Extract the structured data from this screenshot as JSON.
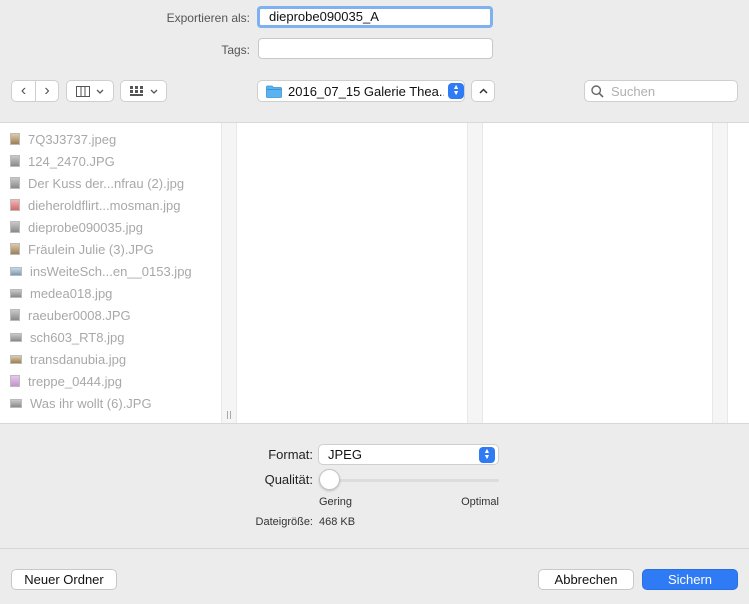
{
  "export": {
    "label": "Exportieren als:",
    "value": "dieprobe090035_A",
    "tags_label": "Tags:",
    "tags_value": ""
  },
  "toolbar": {
    "back_glyph": "‹",
    "forward_glyph": "›",
    "view_columns_icon": "columns-view-icon",
    "view_grid_icon": "grid-view-icon",
    "location": "2016_07_15 Galerie Thea...",
    "expand_glyph": "⌃",
    "search_placeholder": "Suchen"
  },
  "files": [
    {
      "name": "7Q3J3737.jpeg",
      "thumb": "tan"
    },
    {
      "name": "124_2470.JPG",
      "thumb": "gray"
    },
    {
      "name": "Der Kuss der...nfrau (2).jpg",
      "thumb": "gray"
    },
    {
      "name": "dieheroldflirt...mosman.jpg",
      "thumb": "red"
    },
    {
      "name": "dieprobe090035.jpg",
      "thumb": "gray"
    },
    {
      "name": "Fräulein Julie (3).JPG",
      "thumb": "tan"
    },
    {
      "name": "insWeiteSch...en__0153.jpg",
      "thumb": "blue"
    },
    {
      "name": "medea018.jpg",
      "thumb": "gray"
    },
    {
      "name": "raeuber0008.JPG",
      "thumb": "gray"
    },
    {
      "name": "sch603_RT8.jpg",
      "thumb": "gray"
    },
    {
      "name": "transdanubia.jpg",
      "thumb": "tan"
    },
    {
      "name": "treppe_0444.jpg",
      "thumb": "pink"
    },
    {
      "name": "Was ihr wollt (6).JPG",
      "thumb": "gray"
    }
  ],
  "options": {
    "format_label": "Format:",
    "format_value": "JPEG",
    "quality_label": "Qualität:",
    "quality_value": 0,
    "quality_min": "Gering",
    "quality_max": "Optimal",
    "size_label": "Dateigröße:",
    "size_value": "468 KB"
  },
  "buttons": {
    "new_folder": "Neuer Ordner",
    "cancel": "Abbrechen",
    "save": "Sichern"
  },
  "colors": {
    "accent": "#2f7bf5",
    "focus_ring": "#7fb0f0"
  }
}
